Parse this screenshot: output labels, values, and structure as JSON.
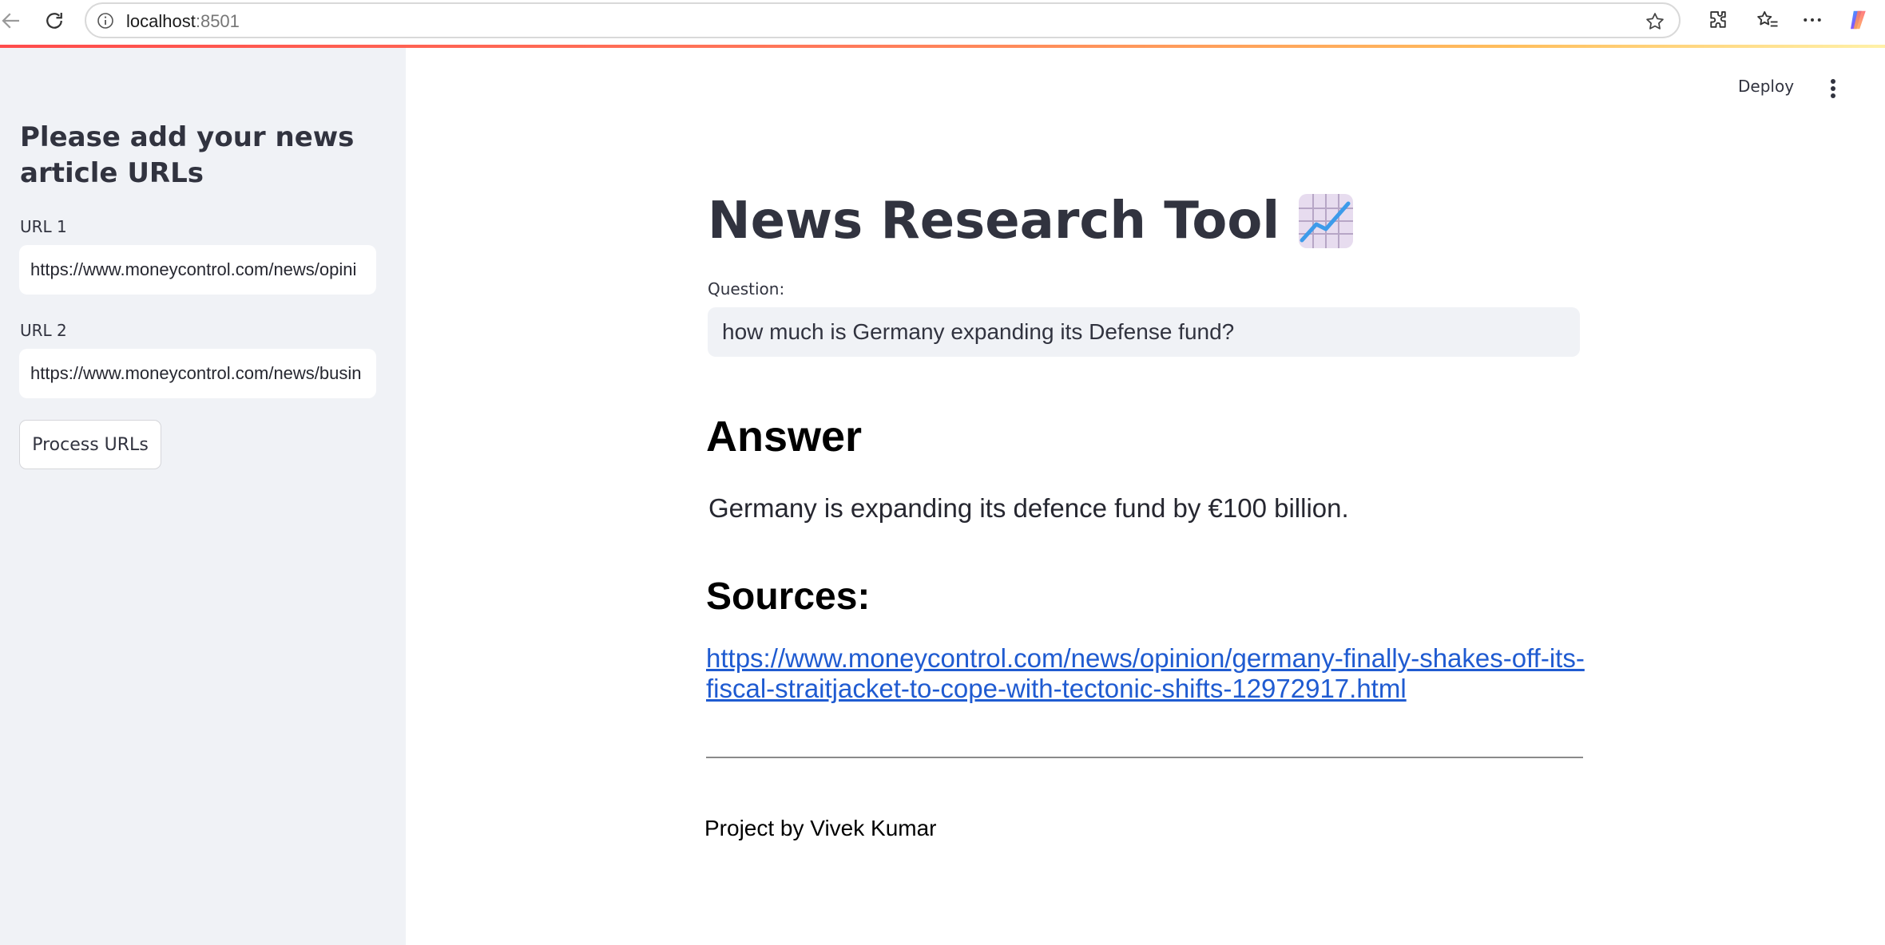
{
  "browser": {
    "url_host": "localhost",
    "url_port": ":8501"
  },
  "sidebar": {
    "heading": "Please add your news article URLs",
    "url1_label": "URL 1",
    "url1_value": "https://www.moneycontrol.com/news/opini",
    "url2_label": "URL 2",
    "url2_value": "https://www.moneycontrol.com/news/busin",
    "process_button": "Process URLs"
  },
  "header": {
    "deploy_label": "Deploy"
  },
  "main": {
    "title": "News Research Tool",
    "question_label": "Question:",
    "question_value": "how much is Germany expanding its Defense fund?",
    "answer_heading": "Answer",
    "answer_text": "Germany is expanding its defence fund by €100 billion.",
    "sources_heading": "Sources:",
    "source_link": "https://www.moneycontrol.com/news/opinion/germany-finally-shakes-off-its-fiscal-straitjacket-to-cope-with-tectonic-shifts-12972917.html",
    "footer": "Project by Vivek Kumar"
  },
  "colors": {
    "accent": "#ff4b4b",
    "sidebar_bg": "#f0f2f6",
    "text": "#31333f",
    "link": "#1f5bd1"
  },
  "icons": {
    "title_emoji": "chart-increasing-icon",
    "main_menu": "vertical-ellipsis-icon"
  }
}
